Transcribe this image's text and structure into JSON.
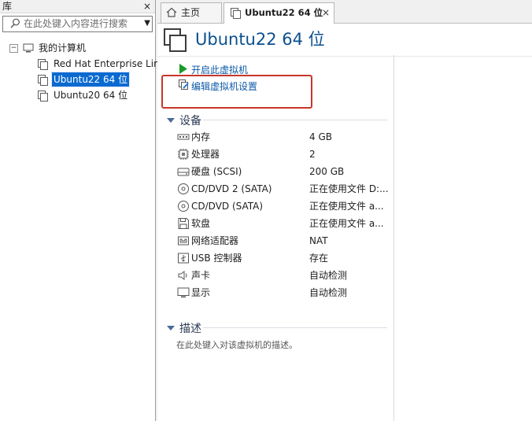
{
  "library": {
    "title": "库",
    "close": "×",
    "search_placeholder": "在此处键入内容进行搜索",
    "tree": {
      "root": "我的计算机",
      "items": [
        "Red Hat Enterprise Lir",
        "Ubuntu22 64 位",
        "Ubuntu20 64 位"
      ]
    }
  },
  "tabs": [
    {
      "label": "主页",
      "icon": "home-icon"
    },
    {
      "label": "Ubuntu22 64 位",
      "icon": "vm-icon",
      "close": "×"
    }
  ],
  "vm": {
    "title": "Ubuntu22 64 位",
    "actions": {
      "power_on": "开启此虚拟机",
      "edit_settings": "编辑虚拟机设置"
    },
    "devices_title": "设备",
    "devices": [
      {
        "name": "内存",
        "value": "4 GB",
        "icon": "memory-icon"
      },
      {
        "name": "处理器",
        "value": "2",
        "icon": "cpu-icon"
      },
      {
        "name": "硬盘 (SCSI)",
        "value": "200 GB",
        "icon": "harddisk-icon"
      },
      {
        "name": "CD/DVD 2 (SATA)",
        "value": "正在使用文件 D:...",
        "icon": "cdrom-icon"
      },
      {
        "name": "CD/DVD (SATA)",
        "value": "正在使用文件 a...",
        "icon": "cdrom-icon"
      },
      {
        "name": "软盘",
        "value": "正在使用文件 a...",
        "icon": "floppy-icon"
      },
      {
        "name": "网络适配器",
        "value": "NAT",
        "icon": "network-icon"
      },
      {
        "name": "USB 控制器",
        "value": "存在",
        "icon": "usb-icon"
      },
      {
        "name": "声卡",
        "value": "自动检测",
        "icon": "speaker-icon"
      },
      {
        "name": "显示",
        "value": "自动检测",
        "icon": "monitor-icon"
      }
    ],
    "description_title": "描述",
    "description_placeholder": "在此处键入对该虚拟机的描述。"
  },
  "colors": {
    "accent": "#0b5aa8",
    "selection": "#0a6ad0",
    "highlight_box": "#c8362a",
    "play_green": "#1a9a2a"
  }
}
